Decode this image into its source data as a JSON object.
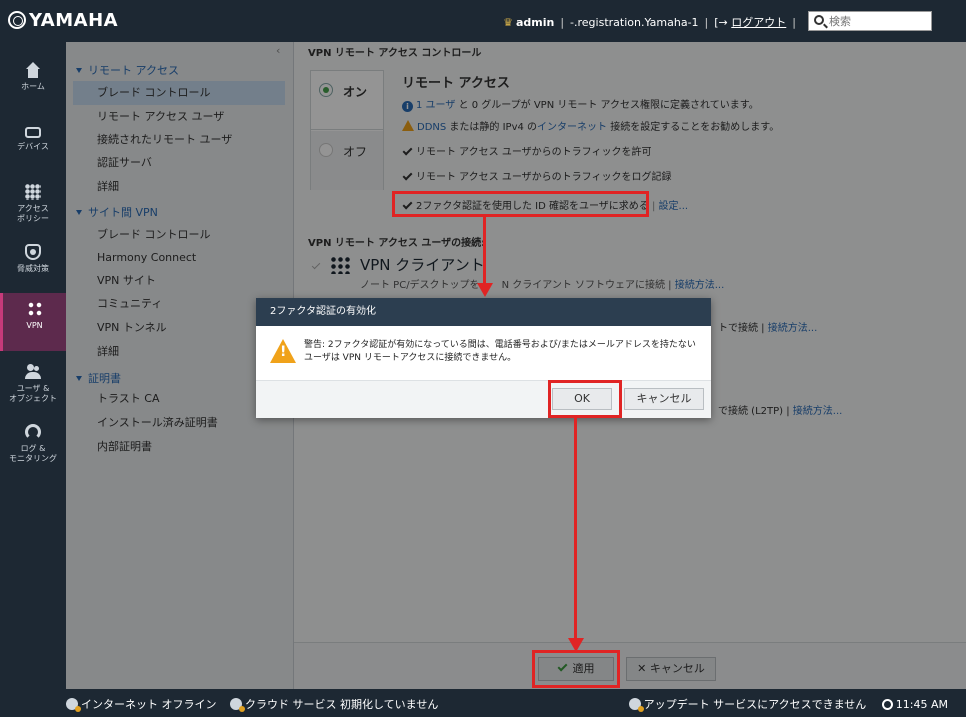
{
  "topbar": {
    "logo": "YAMAHA",
    "user": "admin",
    "device": "-.registration.Yamaha-1",
    "logout": "ログアウト",
    "search_placeholder": "検索"
  },
  "iconnav": {
    "home": "ホーム",
    "device": "デバイス",
    "access_policy_1": "アクセス",
    "access_policy_2": "ポリシー",
    "threat": "脅威対策",
    "vpn": "VPN",
    "users_1": "ユーザ &",
    "users_2": "オブジェクト",
    "logs_1": "ログ &",
    "logs_2": "モニタリング"
  },
  "subnav": {
    "collapse": "‹",
    "section_remote": "リモート アクセス",
    "remote_items": [
      "ブレード コントロール",
      "リモート アクセス ユーザ",
      "接続されたリモート ユーザ",
      "認証サーバ",
      "詳細"
    ],
    "section_site": "サイト間 VPN",
    "site_items": [
      "ブレード コントロール",
      "Harmony Connect",
      "VPN サイト",
      "コミュニティ",
      "VPN トンネル",
      "詳細"
    ],
    "section_cert": "証明書",
    "cert_items": [
      "トラスト CA",
      "インストール済み証明書",
      "内部証明書"
    ]
  },
  "main": {
    "title": "VPN リモート アクセス コントロール",
    "on_label": "オン",
    "off_label": "オフ",
    "remote_title": "リモート アクセス",
    "info_user_link": "1 ユーザ",
    "info_rest": "と 0 グループが VPN リモート アクセス権限に定義されています。",
    "warn_ddns": "DDNS",
    "warn_mid": "または静的 IPv4 の",
    "warn_internet": "インターネット",
    "warn_rest": "接続を設定することをお勧めします。",
    "check1": "リモート アクセス ユーザからのトラフィックを許可",
    "check2": "リモート アクセス ユーザからのトラフィックをログ記録",
    "check3": "2ファクタ認証を使用した ID 確認をユーザに求める",
    "check3_link": "設定...",
    "sub_title": "VPN リモート アクセス ユーザの接続:",
    "client_title": "VPN クライアント",
    "client_desc_a": "ノート PC/デスクトップを",
    "client_desc_b": "N クライアント ソフトウェアに接続 |",
    "client_link": "接続方法...",
    "peek1_a": "トで接続 |",
    "peek1_link": "接続方法...",
    "peek2_a": "で接続 (L2TP) |",
    "peek2_link": "接続方法...",
    "apply": "適用",
    "cancel": "キャンセル"
  },
  "dialog": {
    "title": "2ファクタ認証の有効化",
    "message": "警告: 2ファクタ認証が有効になっている間は、電話番号および/またはメールアドレスを持たないユーザは VPN リモートアクセスに接続できません。",
    "ok": "OK",
    "cancel": "キャンセル"
  },
  "statusbar": {
    "internet": "インターネット オフライン",
    "cloud": "クラウド サービス 初期化していません",
    "update": "アップデート サービスにアクセスできません",
    "time": "11:45 AM"
  },
  "colors": {
    "accent": "#2a6bb5",
    "annotation": "#e02424",
    "warning": "#f0a21a",
    "active_nav": "#5d2a4d"
  }
}
